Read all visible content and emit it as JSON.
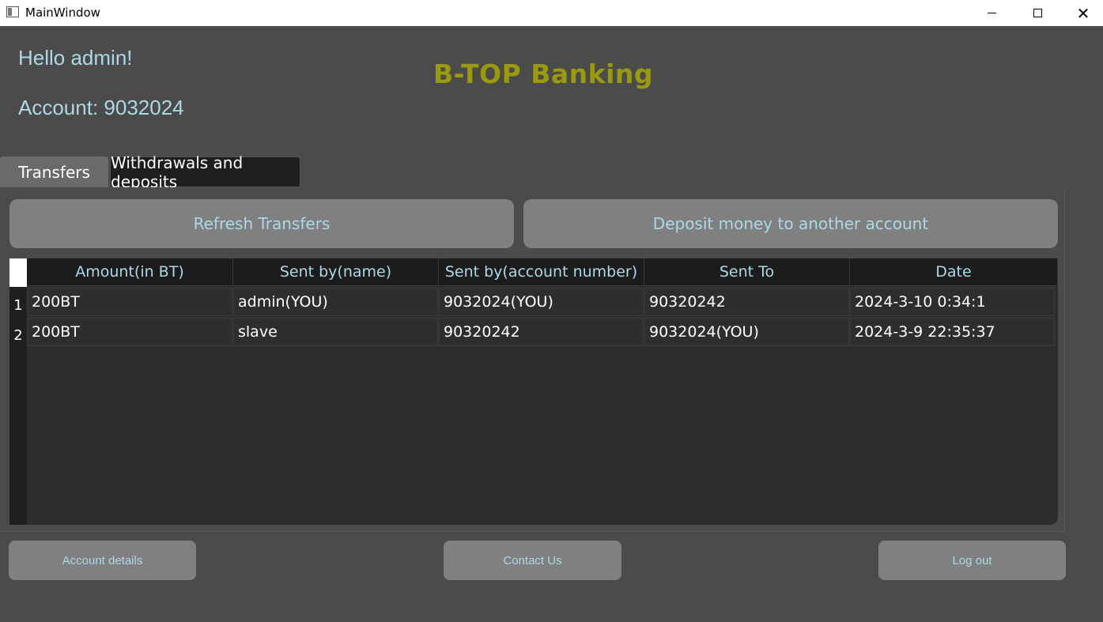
{
  "window": {
    "title": "MainWindow",
    "icon": "window-app-icon",
    "controls": [
      "minimize-icon",
      "maximize-icon",
      "close-icon"
    ],
    "close_glyph": "✕"
  },
  "header": {
    "greeting": "Hello admin!",
    "account_label": "Account: 9032024",
    "brand": "B-TOP Banking",
    "brand_color": "#9a9a0a",
    "text_color": "#add8e6"
  },
  "tabs": [
    {
      "label": "Transfers",
      "selected": false
    },
    {
      "label": "Withdrawals and deposits",
      "selected": true
    }
  ],
  "actions": {
    "refresh": "Refresh Transfers",
    "deposit": "Deposit money to another account"
  },
  "table": {
    "columns": [
      "Amount(in BT)",
      "Sent by(name)",
      "Sent by(account number)",
      "Sent To",
      "Date"
    ],
    "rows": [
      {
        "num": "1",
        "cells": [
          "200BT",
          "admin(YOU)",
          "9032024(YOU)",
          "90320242",
          "2024-3-10 0:34:1"
        ]
      },
      {
        "num": "2",
        "cells": [
          "200BT",
          "slave",
          "90320242",
          "9032024(YOU)",
          "2024-3-9 22:35:37"
        ]
      }
    ]
  },
  "footer": {
    "details": "Account details",
    "contact": "Contact Us",
    "logout": "Log out"
  }
}
